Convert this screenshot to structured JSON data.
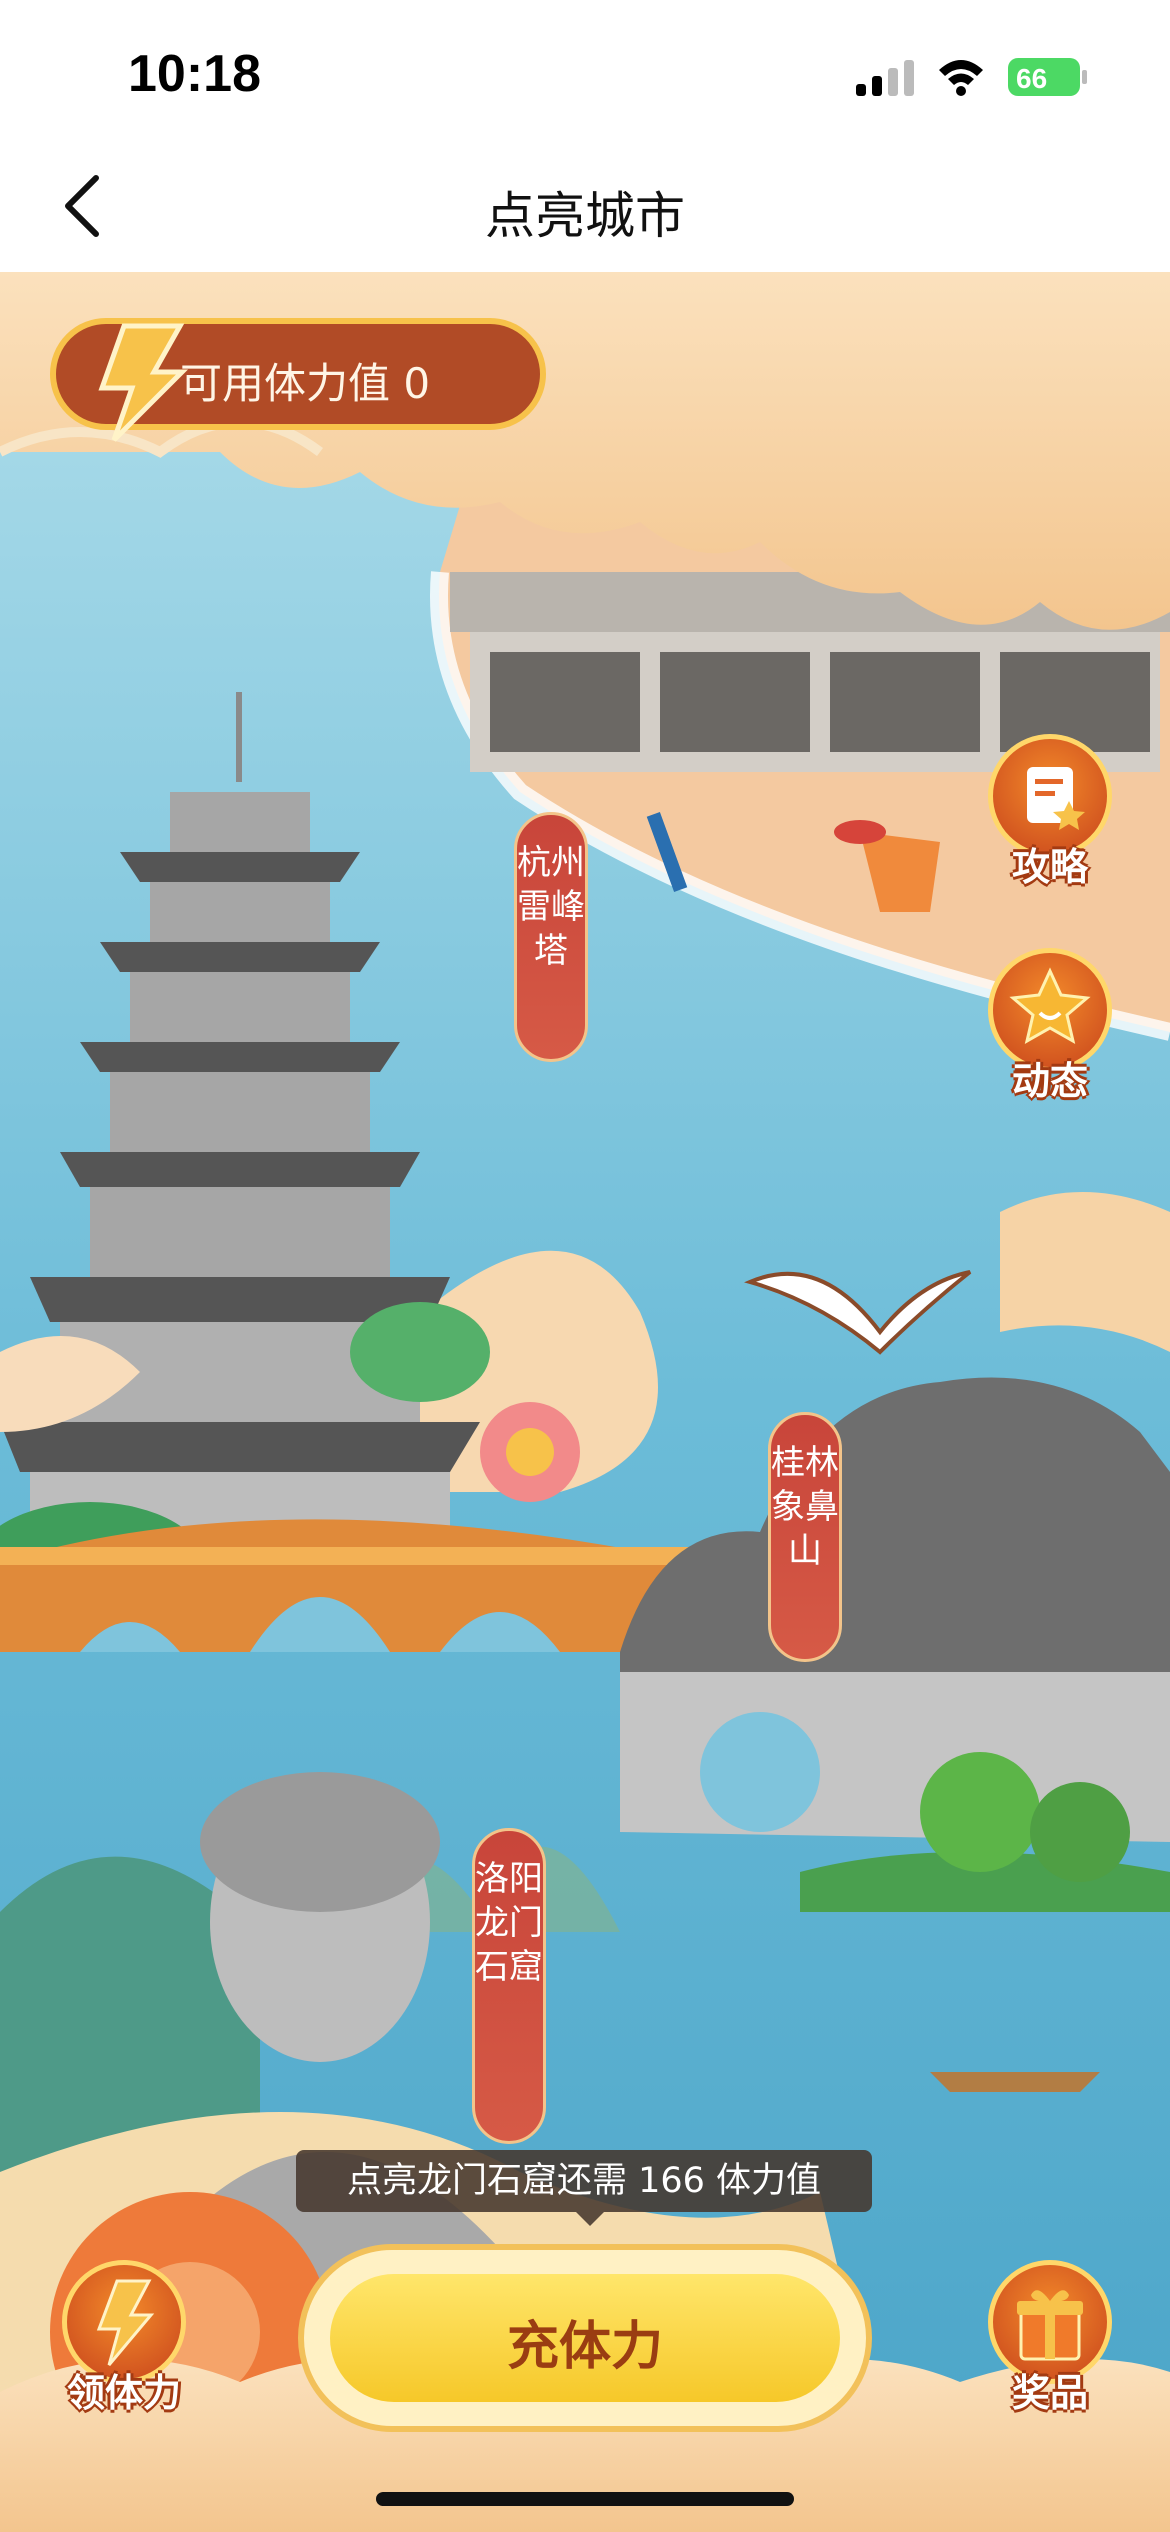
{
  "status_bar": {
    "time": "10:18",
    "battery_level": "66"
  },
  "nav": {
    "title": "点亮城市"
  },
  "energy": {
    "label": "可用体力值 0"
  },
  "landmarks": [
    {
      "name": "杭州雷峰塔"
    },
    {
      "name": "桂林象鼻山"
    },
    {
      "name": "洛阳龙门石窟"
    }
  ],
  "side_buttons": {
    "strategy": "攻略",
    "moments": "动态",
    "get_energy": "领体力",
    "prizes": "奖品"
  },
  "tooltip": {
    "text": "点亮龙门石窟还需 166 体力值"
  },
  "charge_button": {
    "label": "充体力"
  },
  "colors": {
    "accent": "#c8453a",
    "gold": "#f7c24a",
    "water": "#7fc4dc",
    "sand": "#f6d3a6"
  }
}
